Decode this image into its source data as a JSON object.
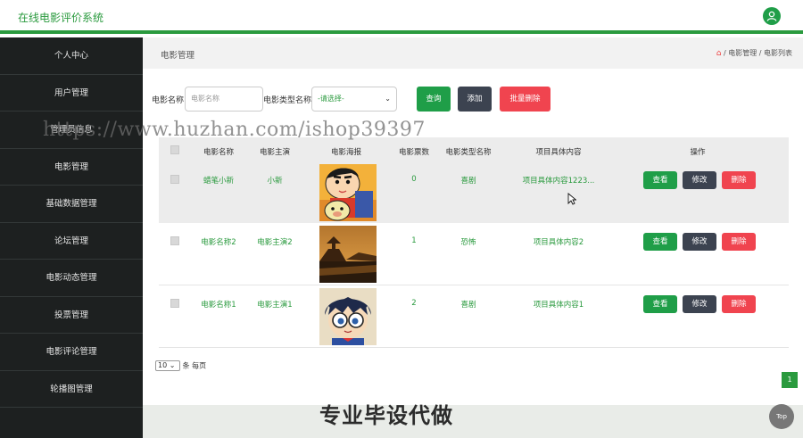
{
  "app": {
    "title": "在线电影评价系统"
  },
  "sidebar": {
    "items": [
      {
        "label": "个人中心"
      },
      {
        "label": "用户管理"
      },
      {
        "label": "管理员信息"
      },
      {
        "label": "电影管理"
      },
      {
        "label": "基础数据管理"
      },
      {
        "label": "论坛管理"
      },
      {
        "label": "电影动态管理"
      },
      {
        "label": "投票管理"
      },
      {
        "label": "电影评论管理"
      },
      {
        "label": "轮播图管理"
      }
    ]
  },
  "page": {
    "title": "电影管理",
    "breadcrumb": [
      "电影管理",
      "电影列表"
    ],
    "separator": "/"
  },
  "search": {
    "name_label": "电影名称",
    "name_placeholder": "电影名称",
    "type_label": "电影类型名称",
    "type_selected": "-请选择-",
    "query_button": "查询",
    "add_button": "添加",
    "batch_delete_button": "批量删除"
  },
  "table": {
    "headers": [
      "电影名称",
      "电影主演",
      "电影海报",
      "电影票数",
      "电影类型名称",
      "项目具体内容",
      "操作"
    ],
    "rows": [
      {
        "name": "蜡笔小新",
        "actor": "小新",
        "votes": "0",
        "type": "喜剧",
        "content": "项目具体内容1223..."
      },
      {
        "name": "电影名称2",
        "actor": "电影主演2",
        "votes": "1",
        "type": "恐怖",
        "content": "项目具体内容2"
      },
      {
        "name": "电影名称1",
        "actor": "电影主演1",
        "votes": "2",
        "type": "喜剧",
        "content": "项目具体内容1"
      }
    ],
    "actions": {
      "view": "查看",
      "edit": "修改",
      "delete": "删除"
    }
  },
  "pagination": {
    "page_size": "10",
    "per_page_label": "条 每页",
    "current_page": "1"
  },
  "overlay": {
    "watermark_url": "https://www.huzhan.com/ishop39397",
    "watermark_text": "专业毕设代做",
    "top_button": "Top"
  },
  "colors": {
    "brand": "#2a9a3e",
    "sidebar": "#1d2020",
    "danger": "#f0444f",
    "dark": "#3c4350"
  }
}
